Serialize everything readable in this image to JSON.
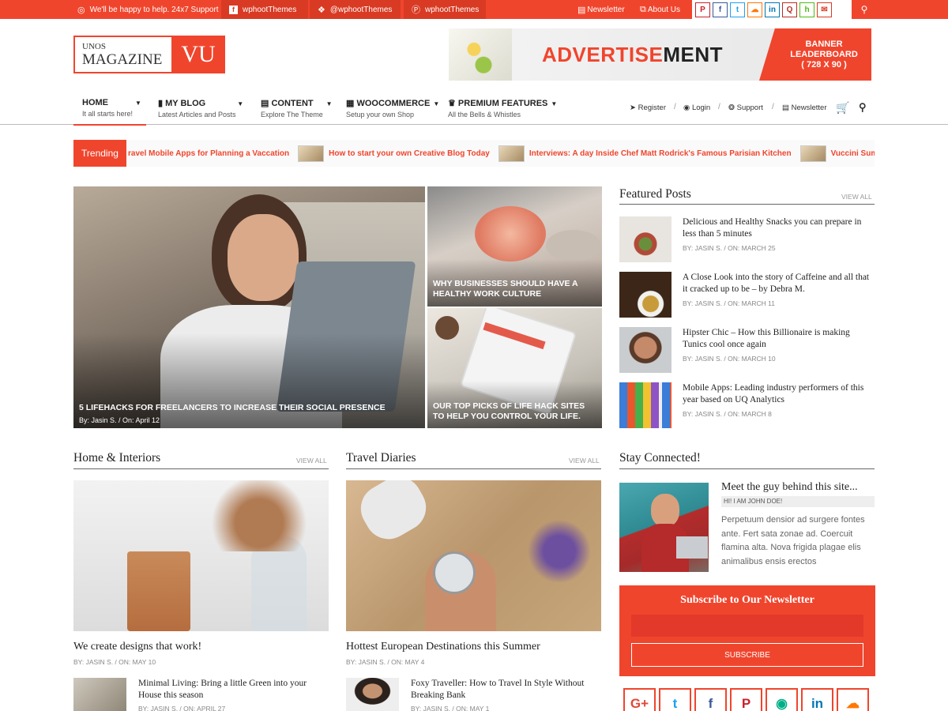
{
  "topbar": {
    "help": "We'll be happy to help. 24x7 Support",
    "facebook": "wphootThemes",
    "twitter": "@wphootThemes",
    "pinterest": "wphootThemes",
    "newsletter": "Newsletter",
    "about": "About Us",
    "social_icons": [
      "pinterest-icon",
      "facebook-icon",
      "twitter-icon",
      "soundcloud-icon",
      "linkedin-icon",
      "quora-icon",
      "houzz-icon",
      "email-icon"
    ]
  },
  "logo": {
    "line1": "UNOS",
    "line2": "MAGAZINE",
    "mark": "VU"
  },
  "ad": {
    "text_a": "ADVERTISE",
    "text_b": "MENT",
    "right1": "BANNER",
    "right2": "LEADERBOARD",
    "right3": "( 728 X 90 )"
  },
  "nav": {
    "items": [
      {
        "label": "HOME",
        "sub": "It all starts here!"
      },
      {
        "label": "MY BLOG",
        "sub": "Latest Articles and Posts"
      },
      {
        "label": "CONTENT",
        "sub": "Explore The Theme"
      },
      {
        "label": "WOOCOMMERCE",
        "sub": "Setup your own Shop"
      },
      {
        "label": "PREMIUM FEATURES",
        "sub": "All the Bells & Whistles"
      }
    ],
    "right": [
      "Register",
      "Login",
      "Support",
      "Newsletter"
    ]
  },
  "trending": {
    "label": "Trending",
    "items": [
      "ravel Mobile Apps for Planning a Vaccation",
      "How to start your own Creative Blog Today",
      "Interviews: A day Inside Chef Matt Rodrick's Famous Parisian Kitchen",
      "Vuccini Summer Co"
    ]
  },
  "hero": {
    "main": {
      "title": "5 LIFEHACKS FOR FREELANCERS TO INCREASE THEIR SOCIAL PRESENCE",
      "meta": "By:  Jasin S.  /   On:  April 12"
    },
    "top_right": {
      "title": "WHY BUSINESSES SHOULD HAVE A HEALTHY WORK CULTURE"
    },
    "bottom_right": {
      "title": "OUR TOP PICKS OF LIFE HACK SITES TO HELP YOU CONTROL YOUR LIFE."
    }
  },
  "featured": {
    "title": "Featured Posts",
    "view_all": "VIEW ALL",
    "posts": [
      {
        "title": "Delicious and Healthy Snacks you can prepare in less than 5 minutes",
        "meta": "BY:  JASIN S.  /   ON:  MARCH 25"
      },
      {
        "title": "A Close Look into the story of Caffeine and all that it cracked up to be – by Debra M.",
        "meta": "BY:  JASIN S.  /   ON:  MARCH 11"
      },
      {
        "title": "Hipster Chic – How this Billionaire is making Tunics cool once again",
        "meta": "BY:  JASIN S.  /   ON:  MARCH 10"
      },
      {
        "title": "Mobile Apps: Leading industry performers of this year based on UQ Analytics",
        "meta": "BY:  JASIN S.  /   ON:  MARCH 8"
      }
    ]
  },
  "home_interiors": {
    "title": "Home & Interiors",
    "view_all": "VIEW ALL",
    "lead_title": "We create designs that work!",
    "lead_meta": "BY:  JASIN S.  /   ON:  MAY 10",
    "small_title": "Minimal Living: Bring a little Green into your House this season",
    "small_meta": "BY:  JASIN S.  /   ON:  APRIL 27"
  },
  "travel": {
    "title": "Travel Diaries",
    "view_all": "VIEW ALL",
    "lead_title": "Hottest European Destinations this Summer",
    "lead_meta": "BY:  JASIN S.  /   ON:  MAY 4",
    "small_title": "Foxy Traveller: How to Travel In Style Without Breaking Bank",
    "small_meta": "BY:  JASIN S.  /   ON:  MAY 1"
  },
  "stay": {
    "title": "Stay Connected!",
    "about_title": "Meet the guy behind this site...",
    "about_sub": "HI! I AM JOHN DOE!",
    "about_text": "Perpetuum densior ad surgere fontes ante. Fert sata zonae ad. Coercuit flamina alta. Nova frigida plagae elis animalibus ensis erectos"
  },
  "newsletter": {
    "title": "Subscribe to Our Newsletter",
    "button": "SUBSCRIBE"
  },
  "bottom_social": [
    "G+",
    "twitter-icon",
    "facebook-icon",
    "pinterest-icon",
    "tripadvisor-icon",
    "in",
    "soundcloud-icon"
  ],
  "colors": {
    "accent": "#f0452d"
  }
}
